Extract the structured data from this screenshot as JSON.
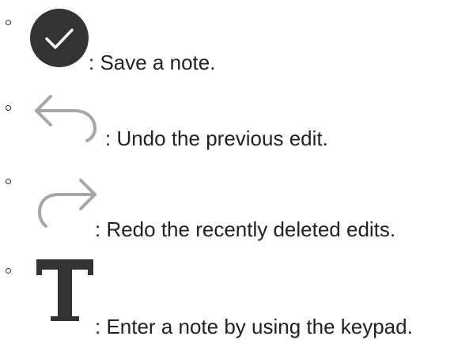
{
  "items": [
    {
      "icon": "checkmark-circle-icon",
      "text": ": Save a note."
    },
    {
      "icon": "undo-arrow-icon",
      "text": ": Undo the previous edit."
    },
    {
      "icon": "redo-arrow-icon",
      "text": ": Redo the recently deleted edits."
    },
    {
      "icon": "text-t-icon",
      "text": ": Enter a note by using the keypad."
    }
  ],
  "colors": {
    "check_circle": "#333333",
    "arrow": "#a6a6a6",
    "t_glyph": "#333333"
  }
}
